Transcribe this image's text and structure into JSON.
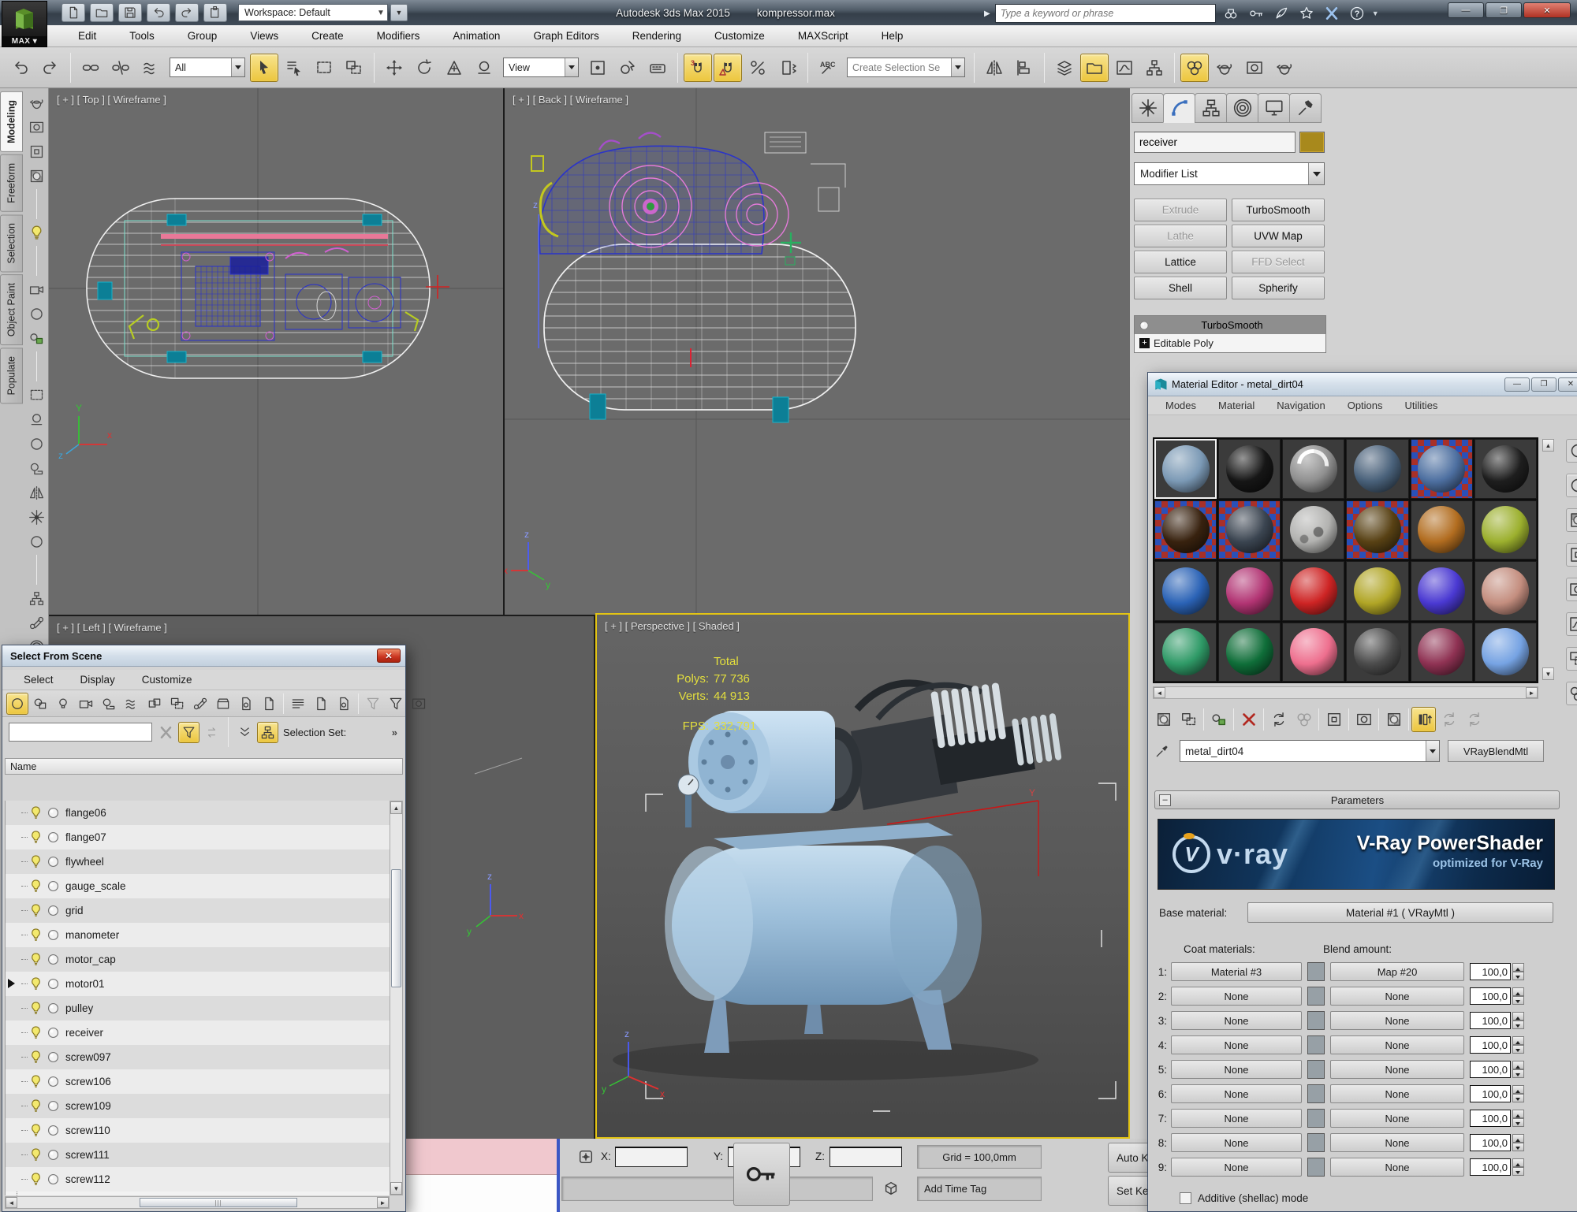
{
  "titlebar": {
    "workspace_label": "Workspace: Default",
    "app_title": "Autodesk 3ds Max 2015",
    "file_name": "kompressor.max",
    "search_placeholder": "Type a keyword or phrase",
    "quick_icons": [
      {
        "icon": "new-scene-icon",
        "sym": "doc"
      },
      {
        "icon": "open-file-icon",
        "sym": "folder"
      },
      {
        "icon": "save-file-icon",
        "sym": "floppy"
      },
      {
        "icon": "undo-icon",
        "sym": "undo"
      },
      {
        "icon": "redo-icon",
        "sym": "redo"
      },
      {
        "icon": "project-folder-icon",
        "sym": "clipboard"
      }
    ],
    "info_icons": [
      {
        "icon": "search-icon",
        "sym": "binoculars"
      },
      {
        "icon": "sign-in-key-icon",
        "sym": "key"
      },
      {
        "icon": "communication-icon",
        "sym": "quill"
      },
      {
        "icon": "favorites-star-icon",
        "sym": "star"
      },
      {
        "icon": "exchange-apps-icon",
        "sym": "xlogo",
        "xblue": true
      },
      {
        "icon": "help-icon",
        "sym": "help"
      }
    ],
    "minimize_glyph": "—",
    "maximize_glyph": "❐",
    "close_glyph": "✕"
  },
  "menubar": {
    "items": [
      "Edit",
      "Tools",
      "Group",
      "Views",
      "Create",
      "Modifiers",
      "Animation",
      "Graph Editors",
      "Rendering",
      "Customize",
      "MAXScript",
      "Help"
    ]
  },
  "main_toolbar": {
    "selection_filter_value": "All",
    "coord_system_value": "View",
    "named_selection_placeholder": "Create Selection Se",
    "icons_a": [
      {
        "icon": "undo-icon",
        "sym": "undo"
      },
      {
        "icon": "redo-icon",
        "sym": "redo"
      },
      {
        "sep": true
      },
      {
        "icon": "select-link-icon",
        "sym": "chain"
      },
      {
        "icon": "unlink-selection-icon",
        "sym": "chainbroken"
      },
      {
        "icon": "bind-spacewarp-icon",
        "sym": "waves"
      }
    ],
    "icons_b": [
      {
        "icon": "select-object-icon",
        "sym": "cursor",
        "active": true
      },
      {
        "icon": "select-by-name-icon",
        "sym": "listcursor"
      },
      {
        "icon": "rect-selection-region-icon",
        "sym": "dashrect"
      },
      {
        "icon": "window-crossing-icon",
        "sym": "tworect"
      },
      {
        "sep": true
      },
      {
        "icon": "select-move-icon",
        "sym": "move"
      },
      {
        "icon": "select-rotate-icon",
        "sym": "rotate"
      },
      {
        "icon": "select-scale-icon",
        "sym": "scale"
      },
      {
        "icon": "select-place-icon",
        "sym": "place"
      }
    ],
    "icons_c": [
      {
        "icon": "use-pivot-center-icon",
        "sym": "pivot"
      },
      {
        "icon": "select-manipulate-icon",
        "sym": "manip"
      },
      {
        "icon": "keyboard-override-icon",
        "sym": "keyboard"
      },
      {
        "sep": true
      },
      {
        "icon": "snap-toggle-3d-icon",
        "sym": "magnet3",
        "active": true
      },
      {
        "icon": "angle-snap-icon",
        "sym": "magnetA",
        "active": true
      },
      {
        "icon": "percent-snap-icon",
        "sym": "percent"
      },
      {
        "icon": "spinner-snap-icon",
        "sym": "spinsnap"
      },
      {
        "sep": true
      },
      {
        "icon": "named-selection-sets-icon",
        "sym": "abc"
      }
    ],
    "icons_d": [
      {
        "sep": true
      },
      {
        "icon": "mirror-icon",
        "sym": "mirror"
      },
      {
        "icon": "align-icon",
        "sym": "align"
      },
      {
        "sep": true
      },
      {
        "icon": "layer-manager-icon",
        "sym": "layers"
      },
      {
        "icon": "ribbon-toggle-icon",
        "sym": "folder",
        "active": true
      },
      {
        "icon": "curve-editor-icon",
        "sym": "chart"
      },
      {
        "icon": "schematic-view-icon",
        "sym": "schematic"
      },
      {
        "sep": true
      },
      {
        "icon": "material-editor-icon",
        "sym": "spheres",
        "active": true
      },
      {
        "icon": "render-setup-icon",
        "sym": "teapot"
      },
      {
        "icon": "rendered-frame-icon",
        "sym": "frame"
      },
      {
        "icon": "render-production-icon",
        "sym": "teapot"
      }
    ]
  },
  "ribbon": {
    "tabs": [
      {
        "label": "Modeling",
        "active": true
      },
      {
        "label": "Freeform"
      },
      {
        "label": "Selection"
      },
      {
        "label": "Object Paint"
      },
      {
        "label": "Populate"
      }
    ],
    "icons": [
      {
        "icon": "polygon-modeling-icon",
        "sym": "teapot"
      },
      {
        "icon": "preview-window-icon",
        "sym": "frame"
      },
      {
        "icon": "grid-panel-icon",
        "sym": "sqinsq"
      },
      {
        "icon": "subobject-grid-icon",
        "sym": "checkerball"
      },
      {
        "sep": true
      },
      {
        "icon": "bulb-link-icon",
        "sym": "bulby"
      },
      {
        "sep": true
      },
      {
        "icon": "camera-tool-icon",
        "sym": "camera"
      },
      {
        "icon": "paint-sphere-icon",
        "sym": "circle"
      },
      {
        "icon": "clone-stack-icon",
        "sym": "copyball"
      },
      {
        "sep": true
      },
      {
        "icon": "slab-icon",
        "sym": "dashrect"
      },
      {
        "icon": "dome-icon",
        "sym": "place"
      },
      {
        "icon": "disc-icon",
        "sym": "circle"
      },
      {
        "icon": "mesh-bowl-icon",
        "sym": "tape"
      },
      {
        "icon": "cone-icon",
        "sym": "mirror"
      },
      {
        "icon": "sun-light-icon",
        "sym": "burst"
      },
      {
        "icon": "olive-shape-icon",
        "sym": "circle"
      },
      {
        "sep": true
      },
      {
        "icon": "waffle-grid-icon",
        "sym": "schematic"
      },
      {
        "icon": "stamp-tool-icon",
        "sym": "bone"
      },
      {
        "icon": "scatter-icon",
        "sym": "motion"
      }
    ]
  },
  "viewports": {
    "top": {
      "label": "[ + ] [ Top ] [ Wireframe ]"
    },
    "back": {
      "label": "[ + ] [ Back ] [ Wireframe ]"
    },
    "left": {
      "label": "[ + ] [ Left ] [ Wireframe ]"
    },
    "perspective": {
      "label": "[ + ] [ Perspective ] [ Shaded ]",
      "stats": {
        "total_label": "Total",
        "polys_label": "Polys:",
        "polys_value": "77 736",
        "verts_label": "Verts:",
        "verts_value": "44 913",
        "fps_label": "FPS:",
        "fps_value": "332,791"
      }
    }
  },
  "select_dialog": {
    "title": "Select From Scene",
    "menus": [
      "Select",
      "Display",
      "Customize"
    ],
    "toolbar": [
      {
        "icon": "display-geometry-icon",
        "sym": "circle",
        "active": true
      },
      {
        "icon": "display-shapes-icon",
        "sym": "shape"
      },
      {
        "icon": "display-lights-icon",
        "sym": "lightbulb"
      },
      {
        "icon": "display-cameras-icon",
        "sym": "camera"
      },
      {
        "icon": "display-helpers-icon",
        "sym": "tape"
      },
      {
        "icon": "display-spacewarps-icon",
        "sym": "waves"
      },
      {
        "icon": "display-groups-icon",
        "sym": "group"
      },
      {
        "icon": "display-xrefs-icon",
        "sym": "tworect"
      },
      {
        "icon": "display-bones-icon",
        "sym": "bone"
      },
      {
        "icon": "display-containers-icon",
        "sym": "container"
      },
      {
        "icon": "display-materials-icon",
        "sym": "docgear"
      },
      {
        "icon": "display-objects-icon",
        "sym": "doc"
      },
      {
        "sep": true
      },
      {
        "icon": "view-list-icon",
        "sym": "listlines"
      },
      {
        "icon": "view-panel-icon",
        "sym": "doc"
      },
      {
        "icon": "view-details-icon",
        "sym": "docgear"
      },
      {
        "sep": true
      },
      {
        "icon": "filter-combinations-icon",
        "sym": "funnel",
        "disabled": true
      },
      {
        "icon": "filter-advanced-icon",
        "sym": "funnel"
      },
      {
        "icon": "notes-icon",
        "sym": "frame"
      }
    ],
    "search_icons": [
      {
        "icon": "clear-search-icon",
        "sym": "xlogo",
        "disabled": true
      },
      {
        "icon": "filter-selected-icon",
        "sym": "funnel",
        "active": true
      },
      {
        "icon": "sync-selection-icon",
        "sym": "sync",
        "disabled": true
      },
      {
        "sep": true
      },
      {
        "icon": "expand-all-icon",
        "sym": "chevdown"
      },
      {
        "icon": "display-children-icon",
        "sym": "hier",
        "active": true
      }
    ],
    "selection_set_label": "Selection Set:",
    "more_chevron": "»",
    "name_header": "Name",
    "items": [
      {
        "name": "flange06"
      },
      {
        "name": "flange07"
      },
      {
        "name": "flywheel"
      },
      {
        "name": "gauge_scale"
      },
      {
        "name": "grid"
      },
      {
        "name": "manometer"
      },
      {
        "name": "motor_cap"
      },
      {
        "name": "motor01",
        "arrow": true
      },
      {
        "name": "pulley"
      },
      {
        "name": "receiver"
      },
      {
        "name": "screw097"
      },
      {
        "name": "screw106"
      },
      {
        "name": "screw109"
      },
      {
        "name": "screw110"
      },
      {
        "name": "screw111"
      },
      {
        "name": "screw112"
      }
    ]
  },
  "command_panel": {
    "tabs": [
      {
        "icon": "create-tab-icon",
        "sym": "burst"
      },
      {
        "icon": "modify-tab-icon",
        "sym": "modarc",
        "active": true
      },
      {
        "icon": "hierarchy-tab-icon",
        "sym": "hier"
      },
      {
        "icon": "motion-tab-icon",
        "sym": "motion"
      },
      {
        "icon": "display-tab-icon",
        "sym": "monitor"
      },
      {
        "icon": "utilities-tab-icon",
        "sym": "hammer"
      }
    ],
    "object_name": "receiver",
    "modifier_list_label": "Modifier List",
    "modifier_buttons": [
      {
        "label": "Extrude",
        "enabled": false
      },
      {
        "label": "TurboSmooth",
        "enabled": true
      },
      {
        "label": "Lathe",
        "enabled": false
      },
      {
        "label": "UVW Map",
        "enabled": true
      },
      {
        "label": "Lattice",
        "enabled": true
      },
      {
        "label": "FFD Select",
        "enabled": false
      },
      {
        "label": "Shell",
        "enabled": true
      },
      {
        "label": "Spherify",
        "enabled": true
      }
    ],
    "stack_rows": {
      "row1": "TurboSmooth",
      "row2": "Editable Poly"
    }
  },
  "material_editor": {
    "window_title": "Material Editor - metal_dirt04",
    "menus": [
      "Modes",
      "Material",
      "Navigation",
      "Options",
      "Utilities"
    ],
    "swatches": [
      {
        "color": "#7b99b5",
        "selected": true
      },
      {
        "color": "#161616"
      },
      {
        "color": "#8f8f8f",
        "kind": "swirl"
      },
      {
        "color": "#49617a"
      },
      {
        "color": "#4d6fa0",
        "kind": "checker"
      },
      {
        "color": "#1e1e1e"
      },
      {
        "color": "#38220f",
        "kind": "checker"
      },
      {
        "color": "#3a4450",
        "kind": "checker"
      },
      {
        "color": "#b2b2b0",
        "kind": "planet"
      },
      {
        "color": "#584114",
        "kind": "checker"
      },
      {
        "color": "#b26d20"
      },
      {
        "color": "#9cb02e"
      },
      {
        "color": "#2b63b6"
      },
      {
        "color": "#b23473"
      },
      {
        "color": "#ce2424"
      },
      {
        "color": "#b1a626"
      },
      {
        "color": "#4a39d2"
      },
      {
        "color": "#c48e7f"
      },
      {
        "color": "#2f9a67"
      },
      {
        "color": "#0f6e39"
      },
      {
        "color": "#ee6f8e"
      },
      {
        "color": "#4b4b4b"
      },
      {
        "color": "#8f3253"
      },
      {
        "color": "#76a3e3"
      }
    ],
    "toolbar": [
      {
        "icon": "get-material-icon",
        "sym": "checkerball"
      },
      {
        "icon": "put-material-scene-icon",
        "sym": "tworect"
      },
      {
        "sep": true
      },
      {
        "icon": "assign-material-icon",
        "sym": "copyball"
      },
      {
        "sep": true
      },
      {
        "icon": "reset-map-icon",
        "sym": "xred"
      },
      {
        "sep": true
      },
      {
        "icon": "make-material-copy-icon",
        "sym": "cycle"
      },
      {
        "icon": "put-to-library-icon",
        "sym": "spheres",
        "disabled": true
      },
      {
        "sep": true
      },
      {
        "icon": "material-id-channel-icon",
        "sym": "sqinsq"
      },
      {
        "sep": true
      },
      {
        "icon": "show-background-icon",
        "sym": "frame"
      },
      {
        "sep": true
      },
      {
        "icon": "show-map-viewport-icon",
        "sym": "checkerball"
      },
      {
        "sep": true
      },
      {
        "icon": "show-end-result-icon",
        "sym": "vbars",
        "active": true
      },
      {
        "icon": "go-to-parent-icon",
        "sym": "cycle",
        "disabled": true
      },
      {
        "icon": "go-forward-sibling-icon",
        "sym": "cycle",
        "disabled": true
      }
    ],
    "pick_icon": "eyedropper-icon",
    "material_name": "metal_dirt04",
    "material_type_button": "VRayBlendMtl",
    "rollout_title": "Parameters",
    "banner": {
      "brand": "v·ray",
      "product": "V-Ray PowerShader",
      "tagline": "optimized for V-Ray"
    },
    "base_material_label": "Base material:",
    "base_material_value": "Material #1  ( VRayMtl )",
    "coat_label": "Coat materials:",
    "blend_label": "Blend amount:",
    "coat_rows": [
      {
        "n": "1:",
        "coat": "Material #3",
        "blend": "Map #20",
        "amount": "100,0"
      },
      {
        "n": "2:",
        "coat": "None",
        "blend": "None",
        "amount": "100,0"
      },
      {
        "n": "3:",
        "coat": "None",
        "blend": "None",
        "amount": "100,0"
      },
      {
        "n": "4:",
        "coat": "None",
        "blend": "None",
        "amount": "100,0"
      },
      {
        "n": "5:",
        "coat": "None",
        "blend": "None",
        "amount": "100,0"
      },
      {
        "n": "6:",
        "coat": "None",
        "blend": "None",
        "amount": "100,0"
      },
      {
        "n": "7:",
        "coat": "None",
        "blend": "None",
        "amount": "100,0"
      },
      {
        "n": "8:",
        "coat": "None",
        "blend": "None",
        "amount": "100,0"
      },
      {
        "n": "9:",
        "coat": "None",
        "blend": "None",
        "amount": "100,0"
      }
    ],
    "additive_checkbox_label": "Additive (shellac) mode"
  },
  "status_bar": {
    "x_label": "X:",
    "y_label": "Y:",
    "z_label": "Z:",
    "grid_text": "Grid = 100,0mm",
    "add_time_tag": "Add Time Tag",
    "auto_key": "Auto Key",
    "set_key": "Set Key"
  }
}
